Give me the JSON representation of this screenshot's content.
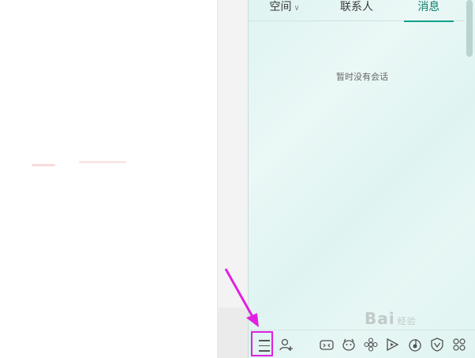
{
  "tabs": [
    {
      "label": "空间",
      "active": false,
      "has_dropdown": true
    },
    {
      "label": "联系人",
      "active": false,
      "has_dropdown": false
    },
    {
      "label": "消息",
      "active": true,
      "has_dropdown": false
    }
  ],
  "messages": {
    "empty_text": "暂时没有会话"
  },
  "bottom_bar": {
    "icons": [
      "main-menu-icon",
      "add-contact-icon",
      "game-icon",
      "pet-icon",
      "photo-icon",
      "video-icon",
      "music-icon",
      "security-icon",
      "app-manager-icon"
    ]
  },
  "watermark": {
    "text": "Bai",
    "suffix": "经验"
  },
  "colors": {
    "panel_bg": "#dff4f1",
    "active_tab": "#0f7f6f",
    "highlight": "#e020e0"
  }
}
